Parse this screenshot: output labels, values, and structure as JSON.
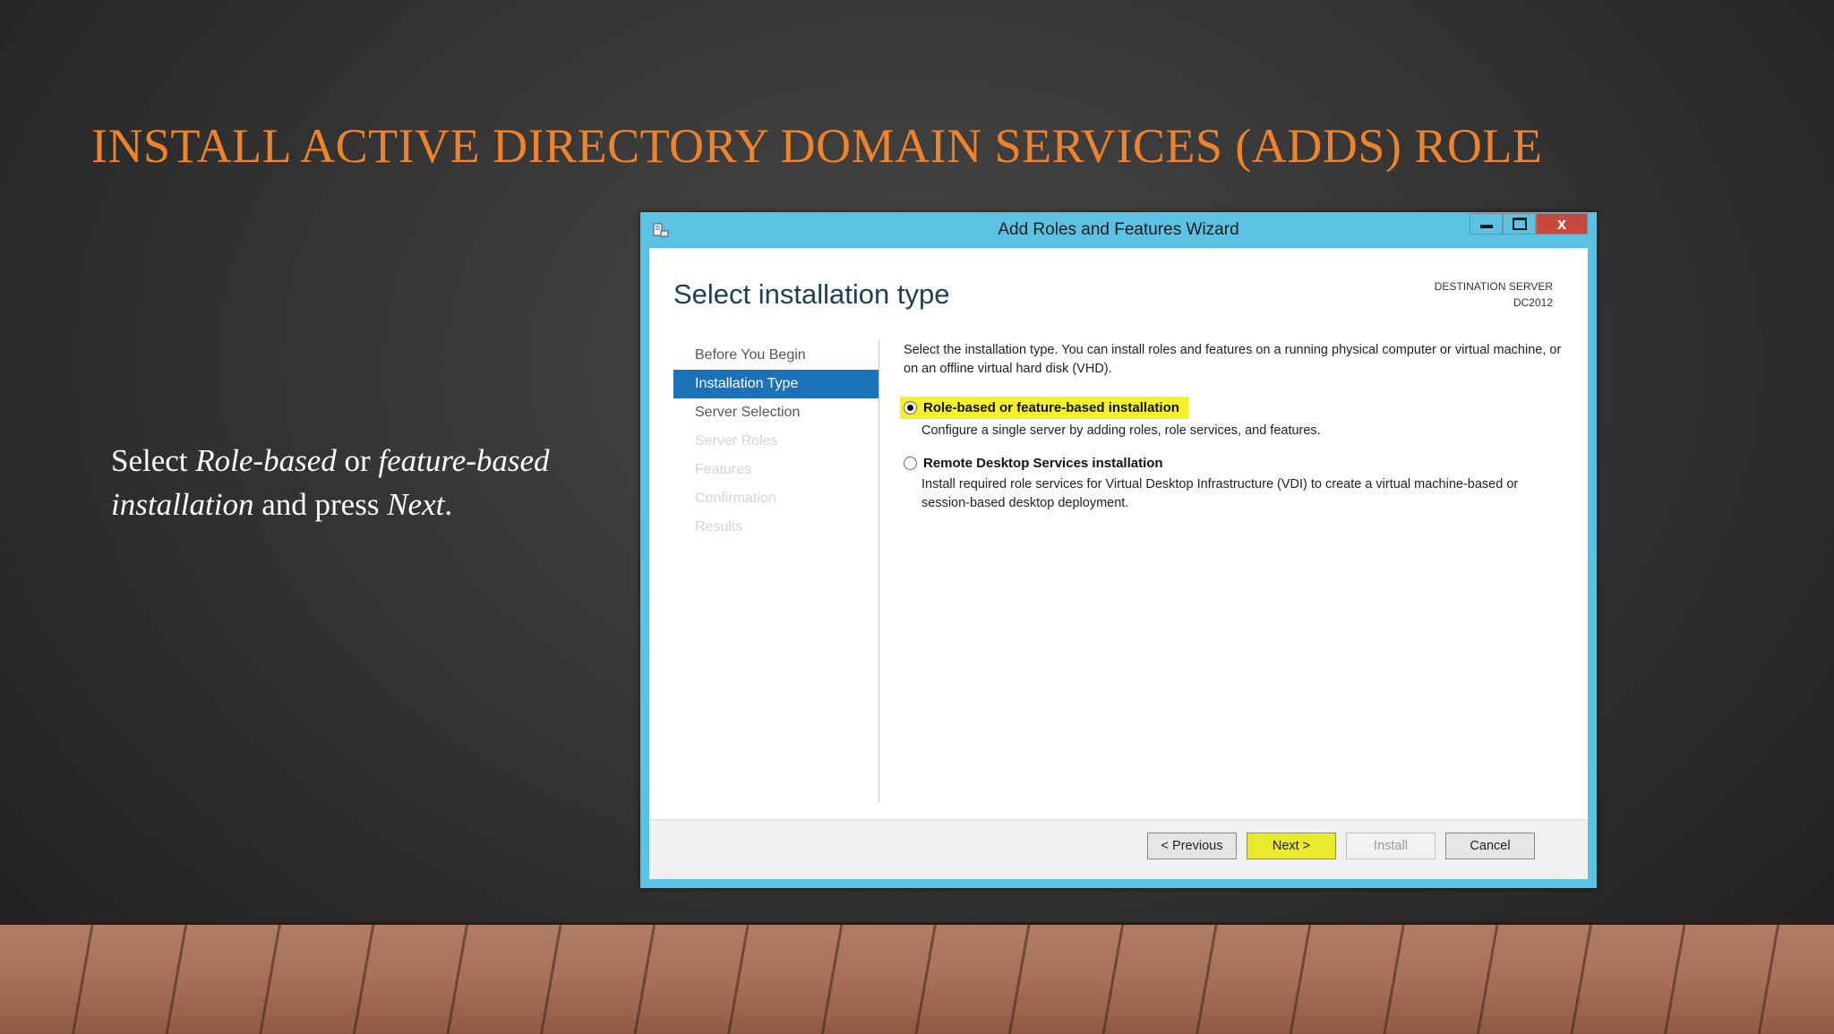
{
  "slide": {
    "title": "INSTALL ACTIVE DIRECTORY DOMAIN SERVICES (ADDS) ROLE",
    "caption": {
      "part1": "Select ",
      "em1": "Role-based",
      "part2": " or ",
      "em2": "feature-based installation",
      "part3": " and press ",
      "em3": "Next",
      "part4": "."
    }
  },
  "window": {
    "title": "Add Roles and Features Wizard",
    "controls": {
      "close_glyph": "x"
    },
    "page_heading": "Select installation type",
    "destination": {
      "label": "DESTINATION SERVER",
      "server": "DC2012"
    },
    "nav": [
      {
        "label": "Before You Begin",
        "state": "normal"
      },
      {
        "label": "Installation Type",
        "state": "active"
      },
      {
        "label": "Server Selection",
        "state": "normal"
      },
      {
        "label": "Server Roles",
        "state": "disabled"
      },
      {
        "label": "Features",
        "state": "disabled"
      },
      {
        "label": "Confirmation",
        "state": "disabled"
      },
      {
        "label": "Results",
        "state": "disabled"
      }
    ],
    "description": "Select the installation type. You can install roles and features on a running physical computer or virtual machine, or on an offline virtual hard disk (VHD).",
    "options": [
      {
        "label": "Role-based or feature-based installation",
        "sub": "Configure a single server by adding roles, role services, and features.",
        "selected": true,
        "highlight_color": "#f4f12a"
      },
      {
        "label": "Remote Desktop Services installation",
        "sub": "Install required role services for Virtual Desktop Infrastructure (VDI) to create a virtual machine-based or session-based desktop deployment.",
        "selected": false
      }
    ],
    "buttons": {
      "previous": "< Previous",
      "next": "Next >",
      "install": "Install",
      "cancel": "Cancel"
    }
  },
  "colors": {
    "title_orange": "#f0822a",
    "window_frame": "#5bc2e4",
    "nav_active": "#1c72b8",
    "highlight_yellow": "#f4f12a",
    "close_red": "#c7493e"
  },
  "icons": {
    "app": "server-manager-icon",
    "radio_selected": "radio-checked-icon",
    "radio_unselected": "radio-unchecked-icon"
  }
}
